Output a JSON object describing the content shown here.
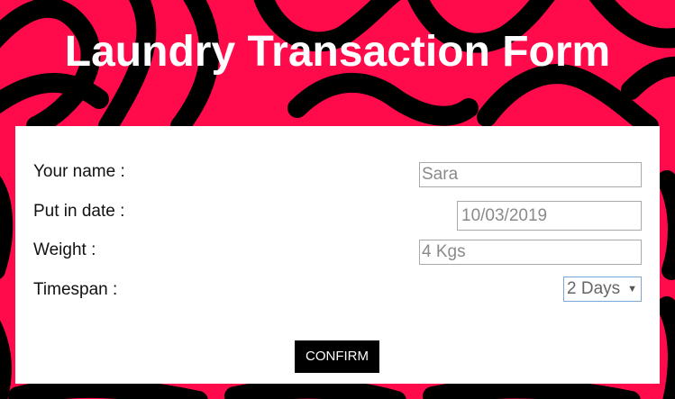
{
  "page": {
    "title": "Laundry Transaction Form"
  },
  "form": {
    "name_label": "Your name :",
    "name_value": "Sara",
    "date_label": "Put in date :",
    "date_value": "10/03/2019",
    "weight_label": "Weight :",
    "weight_value": "4 Kgs",
    "timespan_label": "Timespan :",
    "timespan_value": "2 Days",
    "timespan_caret_icon": "chevron-down-icon",
    "confirm_label": "CONFIRM"
  },
  "colors": {
    "background_red": "#ff0a4a",
    "background_black": "#000000",
    "panel": "#ffffff",
    "button": "#000000"
  }
}
